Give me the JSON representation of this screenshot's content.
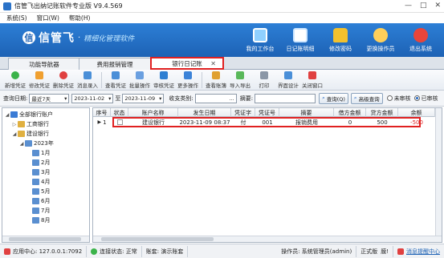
{
  "window": {
    "title": "信管飞出纳记账软件专业版 V9.4.569",
    "min": "—",
    "max": "□",
    "close": "✕"
  },
  "menu": [
    "系统(S)",
    "窗口(W)",
    "帮助(H)"
  ],
  "brand": {
    "name": "信管飞",
    "slogan": "精细化管理软件",
    "mark": "信"
  },
  "topnav": [
    "我的工作台",
    "日记账明细",
    "修改密码",
    "更换操作员",
    "退出系统"
  ],
  "tabs": [
    "功能导航器",
    "费用报销管理",
    "银行日记账"
  ],
  "tab_close": "✕",
  "toolbar": [
    "新增凭证",
    "修改凭证",
    "删除凭证",
    "消息录入",
    "查看凭证",
    "批量操作",
    "审核凭证",
    "更多操作",
    "查看账簿",
    "导入导出",
    "打印",
    "界面设计",
    "关闭窗口"
  ],
  "filter": {
    "date_label": "查询日期:",
    "period": "最近7天",
    "date_from": "2023-11-02",
    "to_label": "至",
    "date_to": "2023-11-09",
    "category_label": "收支类别:",
    "category": "",
    "summary_label": "摘要:",
    "summary": "",
    "query_button": "查询(Q)",
    "advanced_button": "高级查询",
    "unreviewed": "未审核",
    "reviewed": "已审核"
  },
  "tree": [
    {
      "label": "全部银行账户",
      "level": 0,
      "toggle": "◢",
      "icon_color": "#3a7bd5"
    },
    {
      "label": "工商银行",
      "level": 1,
      "toggle": "▷",
      "icon_color": "#e0b040"
    },
    {
      "label": "建设银行",
      "level": 1,
      "toggle": "◢",
      "icon_color": "#e0b040"
    },
    {
      "label": "2023年",
      "level": 2,
      "toggle": "◢",
      "icon_color": "#5a8fd0"
    },
    {
      "label": "1月",
      "level": 3,
      "toggle": "",
      "icon_color": "#5a8fd0"
    },
    {
      "label": "2月",
      "level": 3,
      "toggle": "",
      "icon_color": "#5a8fd0"
    },
    {
      "label": "3月",
      "level": 3,
      "toggle": "",
      "icon_color": "#5a8fd0"
    },
    {
      "label": "4月",
      "level": 3,
      "toggle": "",
      "icon_color": "#5a8fd0"
    },
    {
      "label": "5月",
      "level": 3,
      "toggle": "",
      "icon_color": "#5a8fd0"
    },
    {
      "label": "6月",
      "level": 3,
      "toggle": "",
      "icon_color": "#5a8fd0"
    },
    {
      "label": "7月",
      "level": 3,
      "toggle": "",
      "icon_color": "#5a8fd0"
    },
    {
      "label": "8月",
      "level": 3,
      "toggle": "",
      "icon_color": "#5a8fd0"
    }
  ],
  "grid": {
    "columns": [
      "序号",
      "状态",
      "账户名称",
      "发生日期",
      "凭证字",
      "凭证号",
      "摘要",
      "借方金额",
      "贷方金额",
      "余额"
    ],
    "rows": [
      {
        "seq": "1",
        "status": "",
        "account": "建设银行",
        "date": "2023-11-09 08:37",
        "voucher_type": "付",
        "voucher_no": "001",
        "summary": "报销费用",
        "debit": "0",
        "credit": "500",
        "balance": "-500"
      }
    ]
  },
  "statusbar": {
    "app_center": "应用中心: 127.0.0.1:7092",
    "connection": "连接状态: 正常",
    "account_set": "账套: 演示账套",
    "operator": "操作员: 系统管理员(admin)",
    "edition": "正式版",
    "pinned": "膜!",
    "messages": "消息提醒中心"
  },
  "colors": {
    "accent": "#1d62b5",
    "highlight": "#e02020",
    "negative": "#e02020"
  }
}
